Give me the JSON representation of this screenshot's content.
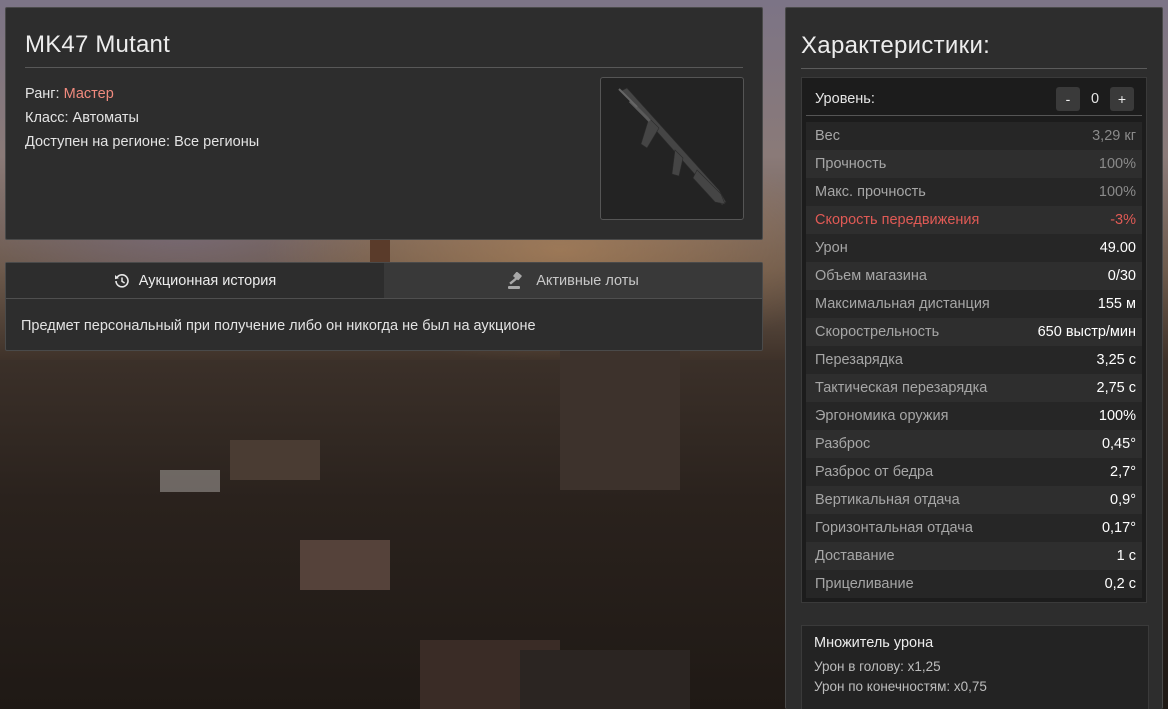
{
  "item": {
    "title": "MK47 Mutant",
    "rank_label": "Ранг:",
    "rank_value": "Мастер",
    "class_label": "Класс:",
    "class_value": "Автоматы",
    "region_label": "Доступен на регионе:",
    "region_value": "Все регионы",
    "image_icon": "assault-rifle-icon"
  },
  "auction": {
    "tabs": [
      {
        "label": "Аукционная история",
        "icon": "history-icon",
        "active": true
      },
      {
        "label": "Активные лоты",
        "icon": "gavel-icon",
        "active": false
      }
    ],
    "message": "Предмет персональный при получение либо он никогда не был на аукционе"
  },
  "stats": {
    "title": "Характеристики:",
    "level_label": "Уровень:",
    "level_value": "0",
    "minus_label": "-",
    "plus_label": "+",
    "rows": [
      {
        "name": "Вес",
        "value": "3,29 кг",
        "style": "dim"
      },
      {
        "name": "Прочность",
        "value": "100%",
        "style": "dim"
      },
      {
        "name": "Макс. прочность",
        "value": "100%",
        "style": "dim"
      },
      {
        "name": "Скорость передвижения",
        "value": "-3%",
        "style": "neg"
      },
      {
        "name": "Урон",
        "value": "49.00",
        "style": ""
      },
      {
        "name": "Объем магазина",
        "value": "0/30",
        "style": ""
      },
      {
        "name": "Максимальная дистанция",
        "value": "155 м",
        "style": ""
      },
      {
        "name": "Скорострельность",
        "value": "650 выстр/мин",
        "style": ""
      },
      {
        "name": "Перезарядка",
        "value": "3,25 с",
        "style": ""
      },
      {
        "name": "Тактическая перезарядка",
        "value": "2,75 с",
        "style": ""
      },
      {
        "name": "Эргономика оружия",
        "value": "100%",
        "style": ""
      },
      {
        "name": "Разброс",
        "value": "0,45°",
        "style": ""
      },
      {
        "name": "Разброс от бедра",
        "value": "2,7°",
        "style": ""
      },
      {
        "name": "Вертикальная отдача",
        "value": "0,9°",
        "style": ""
      },
      {
        "name": "Горизонтальная отдача",
        "value": "0,17°",
        "style": ""
      },
      {
        "name": "Доставание",
        "value": "1 с",
        "style": ""
      },
      {
        "name": "Прицеливание",
        "value": "0,2 с",
        "style": ""
      }
    ]
  },
  "multiplier": {
    "title": "Множитель урона",
    "head": "Урон в голову: x1,25",
    "limbs": "Урон по конечностям: x0,75"
  },
  "colors": {
    "rank": "#f08a7e",
    "negative": "#e05a55",
    "panel": "#2d2d2d"
  }
}
